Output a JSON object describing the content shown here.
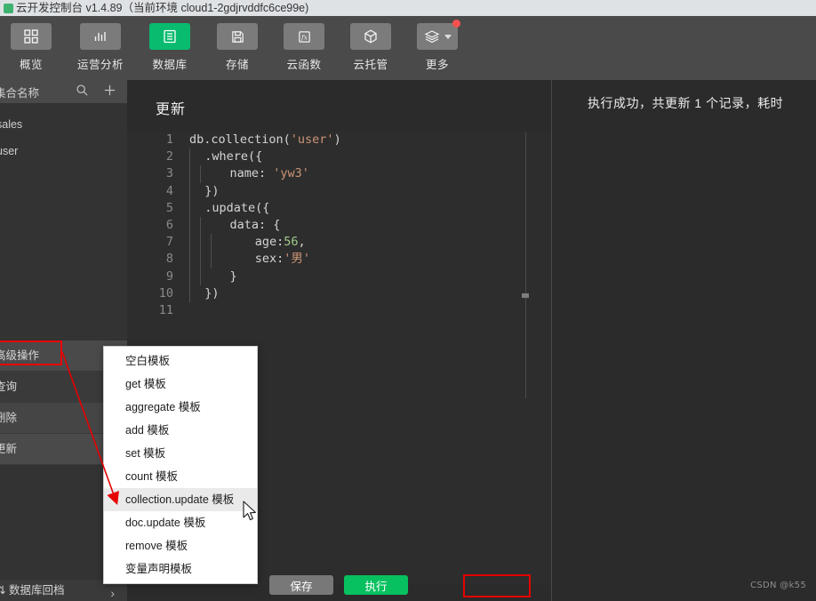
{
  "window": {
    "title": "云开发控制台 v1.4.89（当前环境 cloud1-2gdjrvddfc6ce99e)",
    "logo_icon": "cloud-logo-icon"
  },
  "toolbar": {
    "items": [
      {
        "label": "概览",
        "icon": "grid-icon",
        "active": false,
        "badge": false
      },
      {
        "label": "运营分析",
        "icon": "bar-chart-icon",
        "active": false,
        "badge": false
      },
      {
        "label": "数据库",
        "icon": "database-icon",
        "active": true,
        "badge": false
      },
      {
        "label": "存储",
        "icon": "floppy-disk-icon",
        "active": false,
        "badge": false
      },
      {
        "label": "云函数",
        "icon": "function-fx-icon",
        "active": false,
        "badge": false
      },
      {
        "label": "云托管",
        "icon": "cube-icon",
        "active": false,
        "badge": false
      },
      {
        "label": "更多",
        "icon": "layers-icon",
        "active": false,
        "badge": true
      }
    ],
    "active_color": "#09bb6f",
    "badge_color": "#f5504f"
  },
  "sidebar": {
    "header": {
      "title": "集合名称",
      "search_icon": "search-icon",
      "add_icon": "plus-icon"
    },
    "collections": [
      {
        "name": "sales"
      },
      {
        "name": "user"
      }
    ],
    "actions": [
      {
        "label": "高级操作",
        "highlighted": true
      },
      {
        "label": "查询",
        "highlighted": false
      },
      {
        "label": "删除",
        "highlighted": false
      },
      {
        "label": "更新",
        "highlighted": false
      }
    ],
    "bottom": {
      "label": "数据库回档",
      "icon": "sort-arrows-icon",
      "chevron": "chevron-right-icon"
    }
  },
  "editor": {
    "title": "更新",
    "lines": [
      {
        "no": "1",
        "indent": 0,
        "segments": [
          {
            "t": "db.collection(",
            "c": "plain"
          },
          {
            "t": "'user'",
            "c": "string"
          },
          {
            "t": ")",
            "c": "plain"
          }
        ]
      },
      {
        "no": "2",
        "indent": 1,
        "segments": [
          {
            "t": "  .where({",
            "c": "plain"
          }
        ]
      },
      {
        "no": "3",
        "indent": 2,
        "segments": [
          {
            "t": "    name: ",
            "c": "plain"
          },
          {
            "t": "'yw3'",
            "c": "string"
          }
        ]
      },
      {
        "no": "4",
        "indent": 1,
        "segments": [
          {
            "t": "  })",
            "c": "plain"
          }
        ]
      },
      {
        "no": "5",
        "indent": 1,
        "segments": [
          {
            "t": "  .update({",
            "c": "plain"
          }
        ]
      },
      {
        "no": "6",
        "indent": 2,
        "segments": [
          {
            "t": "    data: {",
            "c": "plain"
          }
        ]
      },
      {
        "no": "7",
        "indent": 3,
        "segments": [
          {
            "t": "      age:",
            "c": "plain"
          },
          {
            "t": "56",
            "c": "number"
          },
          {
            "t": ",",
            "c": "plain"
          }
        ]
      },
      {
        "no": "8",
        "indent": 3,
        "segments": [
          {
            "t": "      sex:",
            "c": "plain"
          },
          {
            "t": "'男'",
            "c": "string"
          }
        ]
      },
      {
        "no": "9",
        "indent": 2,
        "segments": [
          {
            "t": "    }",
            "c": "plain"
          }
        ]
      },
      {
        "no": "10",
        "indent": 1,
        "segments": [
          {
            "t": "  })",
            "c": "plain"
          }
        ]
      },
      {
        "no": "11",
        "indent": 0,
        "segments": [
          {
            "t": "",
            "c": "plain"
          }
        ]
      }
    ]
  },
  "footer": {
    "save_label": "保存",
    "run_label": "执行",
    "run_color": "#07c160",
    "save_color": "#787878"
  },
  "result": {
    "message": "执行成功，共更新 1 个记录，耗时",
    "watermark": "CSDN @k55"
  },
  "menu": {
    "items": [
      {
        "label": "空白模板",
        "hovered": false
      },
      {
        "label": "get 模板",
        "hovered": false
      },
      {
        "label": "aggregate 模板",
        "hovered": false
      },
      {
        "label": "add 模板",
        "hovered": false
      },
      {
        "label": "set 模板",
        "hovered": false
      },
      {
        "label": "count 模板",
        "hovered": false
      },
      {
        "label": "collection.update 模板",
        "hovered": true
      },
      {
        "label": "doc.update 模板",
        "hovered": false
      },
      {
        "label": "remove 模板",
        "hovered": false
      },
      {
        "label": "变量声明模板",
        "hovered": false
      }
    ]
  },
  "annotations": {
    "color": "#e60000",
    "arrow_label": "red-arrow-pointer"
  }
}
